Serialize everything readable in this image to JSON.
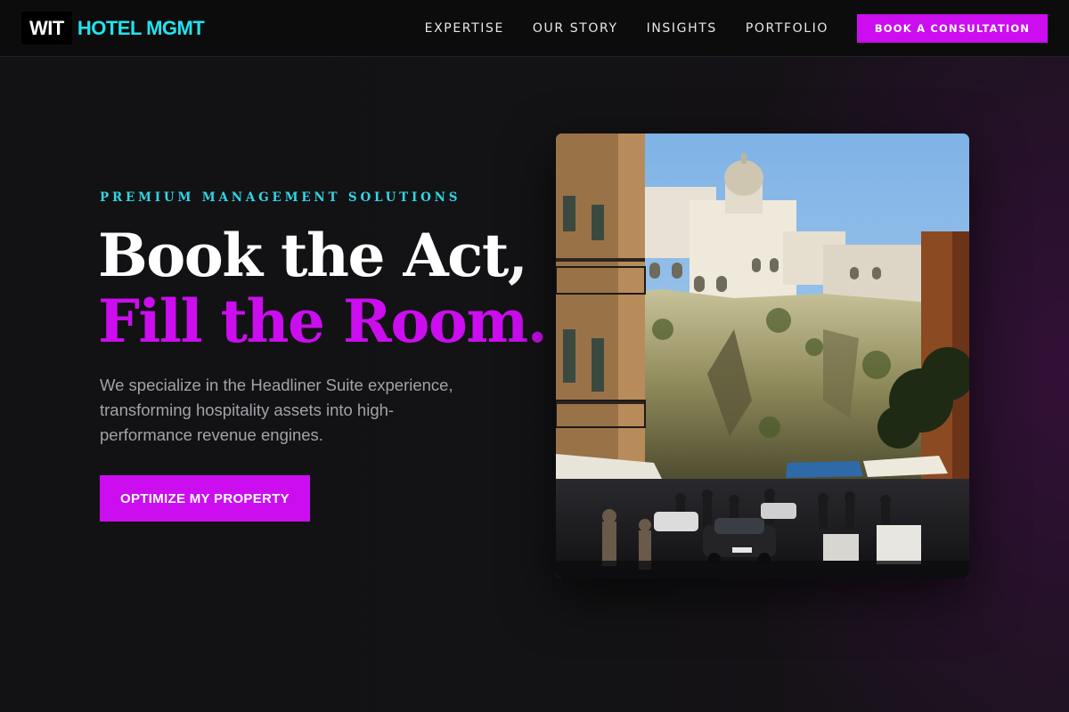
{
  "nav": {
    "logo_mark": "WIT",
    "logo_text": "HOTEL MGMT",
    "links": [
      "EXPERTISE",
      "OUR STORY",
      "INSIGHTS",
      "PORTFOLIO"
    ],
    "cta_label": "BOOK A CONSULTATION"
  },
  "hero": {
    "eyebrow": "PREMIUM MANAGEMENT SOLUTIONS",
    "headline_line1": "Book the Act,",
    "headline_line2": "Fill the Room.",
    "description": "We specialize in the Headliner Suite experience, transforming hospitality assets into high-performance revenue engines.",
    "cta_label": "OPTIMIZE MY PROPERTY"
  },
  "colors": {
    "accent": "#cc0df0",
    "brand_cyan": "#22e3ee",
    "background": "#111012"
  },
  "icons": {
    "hero_image": "mediterranean-street-photo"
  }
}
